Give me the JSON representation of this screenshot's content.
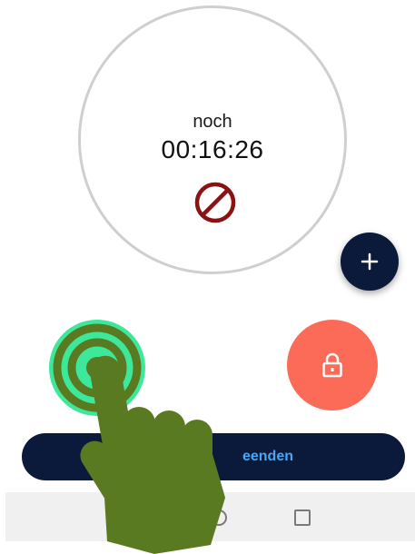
{
  "timer": {
    "label": "noch",
    "time": "00:16:26",
    "icon": "cancel-icon"
  },
  "fab": {
    "icon": "plus-icon"
  },
  "controls": {
    "unlock_icon": "unlock-icon",
    "lock_icon": "lock-icon"
  },
  "end_button": {
    "label": "eenden"
  },
  "navbar": {
    "home_icon": "circle-icon",
    "recent_icon": "square-icon"
  },
  "overlay": {
    "icon": "tap-hand-icon"
  },
  "colors": {
    "navy": "#0b1a3a",
    "green": "#3ee89a",
    "coral": "#fb6b57",
    "cancel_red": "#8b1212",
    "end_text": "#4aa6f5",
    "hand_green": "#5a7a22"
  }
}
